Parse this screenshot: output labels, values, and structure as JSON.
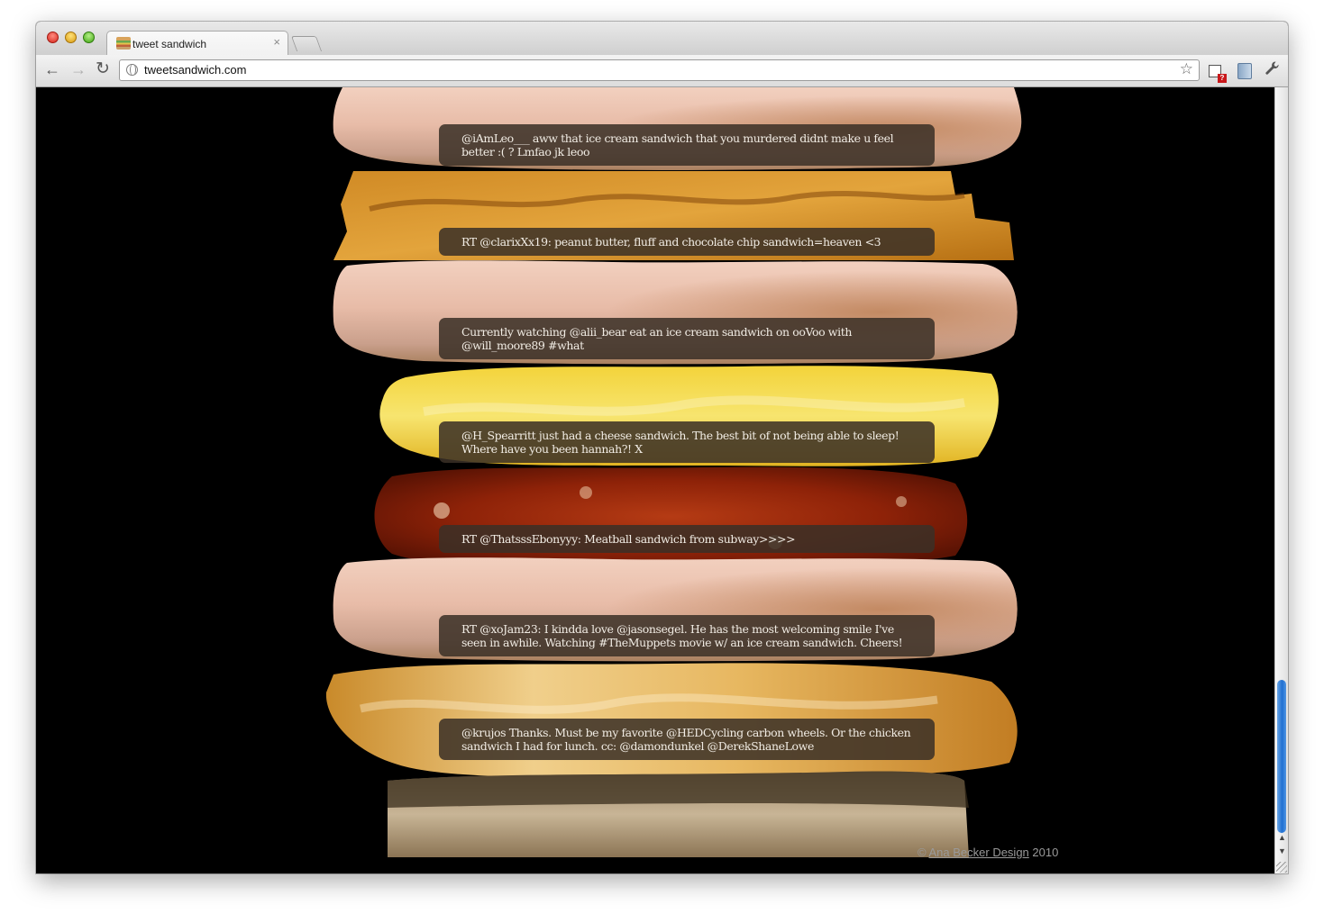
{
  "browser": {
    "tab_title": "tweet sandwich",
    "tab_close": "×",
    "url": "tweetsandwich.com",
    "back_glyph": "←",
    "forward_glyph": "→",
    "reload_glyph": "↻",
    "star_glyph": "☆",
    "wrench_glyph": "🔧",
    "badge_text": "?"
  },
  "tweets": [
    {
      "text": "@iAmLeo___ aww that ice cream sandwich that you murdered didnt make u feel better :( ? Lmfao jk leoo",
      "layer": "bread-top"
    },
    {
      "text": "RT @clarixXx19: peanut butter, fluff and chocolate chip sandwich=heaven <3",
      "layer": "peanut-butter"
    },
    {
      "text": "Currently watching @alii_bear eat an ice cream sandwich on ooVoo with @will_moore89 #what",
      "layer": "bread"
    },
    {
      "text": "@H_Spearritt just had a cheese sandwich. The best bit of not being able to sleep! Where have you been hannah?! X",
      "layer": "cheese"
    },
    {
      "text": "RT @ThatsssEbonyyy: Meatball sandwich from subway>>>>",
      "layer": "meatball"
    },
    {
      "text": "RT @xoJam23: I kindda love @jasonsegel. He has the most welcoming smile I've seen in awhile. Watching #TheMuppets movie w/ an ice cream sandwich. Cheers!",
      "layer": "bread"
    },
    {
      "text": "@krujos Thanks. Must be my favorite @HEDCycling carbon wheels. Or the chicken sandwich I had for lunch. cc: @damondunkel @DerekShaneLowe",
      "layer": "chicken"
    }
  ],
  "footer": {
    "copyright": "©",
    "author": "Ana Becker Design",
    "year": "2010"
  },
  "colors": {
    "tweet_bubble": "#3a3026",
    "page_background": "#000000",
    "scroll_thumb": "#1f6fd1"
  }
}
